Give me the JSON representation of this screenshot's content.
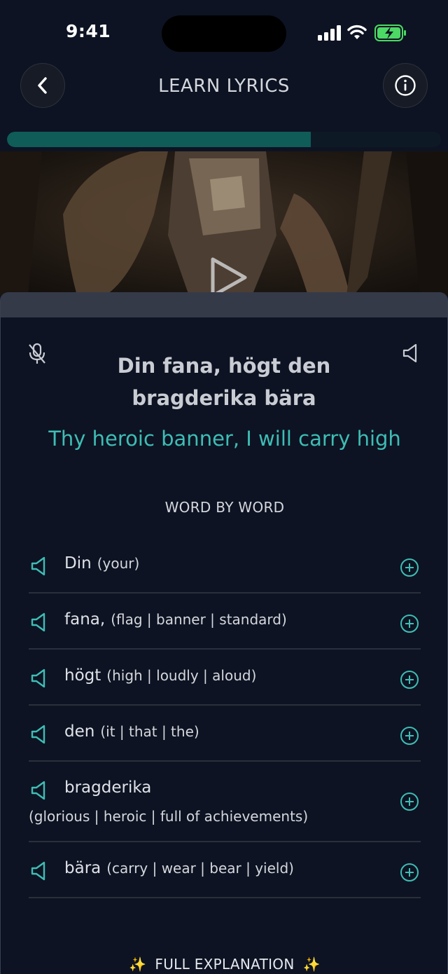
{
  "status": {
    "time": "9:41"
  },
  "header": {
    "title": "LEARN LYRICS"
  },
  "progress": {
    "fraction": 0.7
  },
  "video": {
    "state": "paused"
  },
  "lyric": {
    "original": "Din fana, högt den bragderika bära",
    "translation": "Thy heroic banner, I will carry high"
  },
  "section_label": "WORD BY WORD",
  "words": [
    {
      "word": "Din",
      "meaning": "(your)"
    },
    {
      "word": "fana,",
      "meaning": "(flag | banner | standard)"
    },
    {
      "word": "högt",
      "meaning": "(high | loudly | aloud)"
    },
    {
      "word": "den",
      "meaning": "(it | that | the)"
    },
    {
      "word": "bragderika",
      "meaning": "(glorious | heroic | full of achievements)"
    },
    {
      "word": "bära",
      "meaning": "(carry | wear | bear | yield)"
    }
  ],
  "footer": {
    "full_explanation": "FULL EXPLANATION",
    "sparkle": "✨"
  },
  "icons": {
    "back": "chevron-left-icon",
    "info": "info-icon",
    "mic": "mic-off-icon",
    "speaker": "speaker-icon",
    "add": "plus-circle-icon",
    "play": "play-icon"
  },
  "colors": {
    "accent": "#3ebdb5",
    "progress": "#0f5c59",
    "background": "#0d1322",
    "sheet_handle": "#353a49",
    "battery": "#4cd964"
  }
}
